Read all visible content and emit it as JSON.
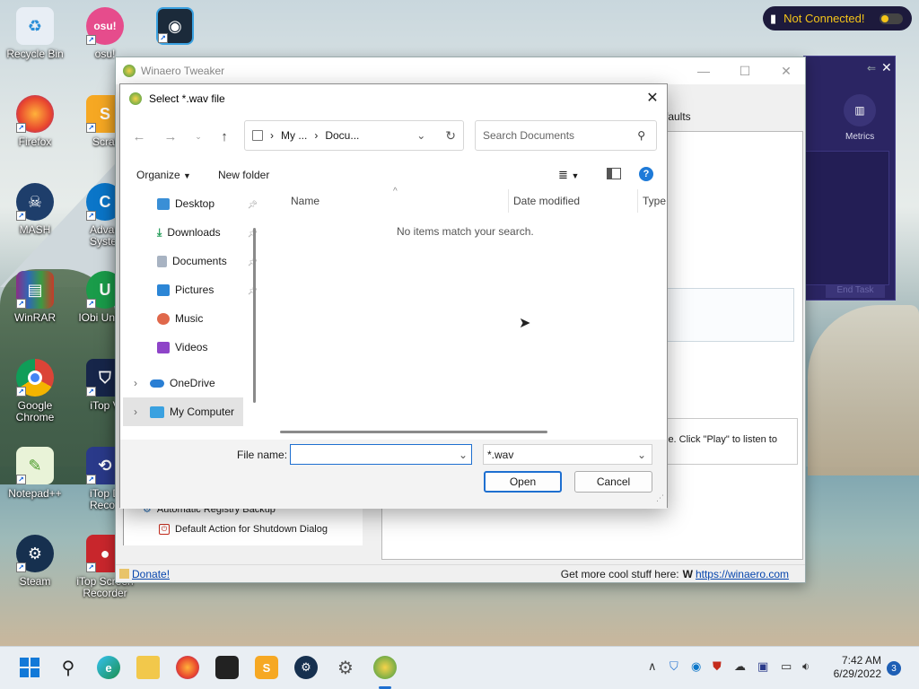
{
  "desktop": {
    "icons": [
      {
        "label": "Recycle Bin"
      },
      {
        "label": "osu!",
        "glyph": "osu!"
      },
      {
        "label": "Firefox"
      },
      {
        "label": "Scrat"
      },
      {
        "label": "MASH"
      },
      {
        "label": "Advan Syster"
      },
      {
        "label": "WinRAR"
      },
      {
        "label": "IObi Uninst"
      },
      {
        "label": "Google Chrome"
      },
      {
        "label": "iTop V"
      },
      {
        "label": "Notepad++"
      },
      {
        "label": "iTop D Recov"
      },
      {
        "label": "Steam"
      },
      {
        "label": "iTop Screen Recorder"
      }
    ]
  },
  "vpn": {
    "status": "Not Connected!"
  },
  "itop_panel": {
    "metrics_label": "Metrics",
    "end_task": "End Task"
  },
  "winaero": {
    "title": "Winaero Tweaker",
    "tab_fragment": "faults",
    "desc_fragment": "le. Click \"Play\" to listen to",
    "tree": [
      "Automatic Registry Backup",
      "Default Action for Shutdown Dialog"
    ],
    "status": {
      "donate": "Donate!",
      "more": "Get more cool stuff here:",
      "url": "https://winaero.com"
    }
  },
  "dialog": {
    "title": "Select *.wav file",
    "address": {
      "seg1": "My ...",
      "seg2": "Docu..."
    },
    "search_placeholder": "Search Documents",
    "organize": "Organize",
    "new_folder": "New folder",
    "nav": [
      {
        "label": "Desktop",
        "color": "#3a8fd6"
      },
      {
        "label": "Downloads",
        "color": "#1f9a55"
      },
      {
        "label": "Documents",
        "color": "#8a97a8"
      },
      {
        "label": "Pictures",
        "color": "#2c86d6"
      },
      {
        "label": "Music",
        "color": "#e0684b"
      },
      {
        "label": "Videos",
        "color": "#8e44c8"
      },
      {
        "label": "OneDrive",
        "color": "#2a7fd4"
      },
      {
        "label": "My Computer",
        "color": "#3aa1e0"
      }
    ],
    "columns": {
      "name": "Name",
      "date": "Date modified",
      "type": "Type"
    },
    "empty_message": "No items match your search.",
    "file_name_label": "File name:",
    "file_name_value": "",
    "filter_value": "*.wav",
    "open": "Open",
    "cancel": "Cancel"
  },
  "tray": {
    "time": "7:42 AM",
    "date": "6/29/2022",
    "notifications": "3"
  }
}
